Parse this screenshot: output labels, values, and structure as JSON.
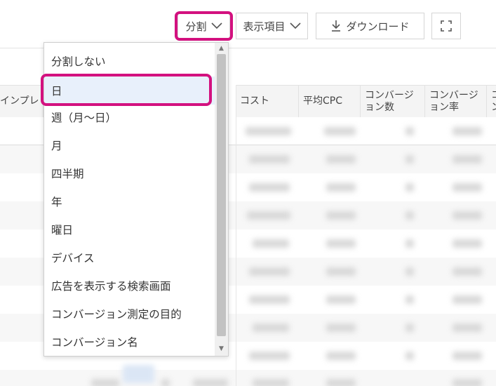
{
  "toolbar": {
    "segment_label": "分割",
    "columns_label": "表示項目",
    "download_label": "ダウンロード"
  },
  "table": {
    "headers": {
      "impressions": "インプレ",
      "cost": "コスト",
      "avg_cpc": "平均CPC",
      "conversions_l1": "コンバージ",
      "conversions_l2": "ョン数",
      "conv_rate_l1": "コンバージ",
      "conv_rate_l2": "ョン率",
      "next_l1": "コ",
      "next_l2": "ン"
    }
  },
  "segment_menu": {
    "items": [
      "分割しない",
      "日",
      "週（月〜日）",
      "月",
      "四半期",
      "年",
      "曜日",
      "デバイス",
      "広告を表示する検索画面",
      "コンバージョン測定の目的",
      "コンバージョン名"
    ],
    "selected": "日"
  },
  "colors": {
    "highlight": "#d3117f",
    "selected_bg": "#e8f0fb"
  }
}
